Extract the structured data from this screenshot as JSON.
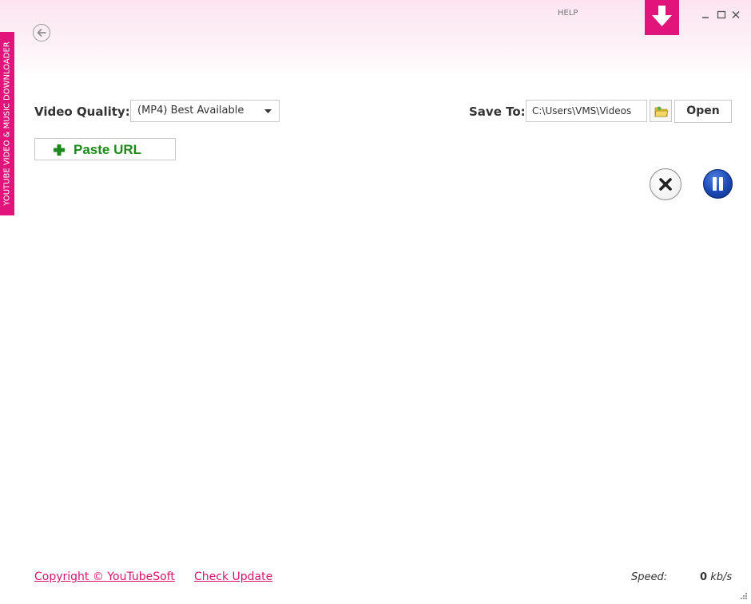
{
  "sidebar": {
    "title": "YOUTUBE VIDEO & MUSIC DOWNLOADER"
  },
  "header": {
    "help_label": "HELP",
    "logo_icon": "download-arrow-icon",
    "window_controls": [
      "minimize-icon",
      "maximize-icon",
      "close-icon"
    ]
  },
  "toolbar": {
    "quality_label": "Video Quality:",
    "quality_selected": "(MP4) Best Available",
    "save_label": "Save To:",
    "save_path": "C:\\Users\\VMS\\Videos",
    "folder_icon": "folder-icon",
    "open_label": "Open",
    "paste_label": "Paste URL"
  },
  "actions": {
    "cancel_icon": "cancel-icon",
    "pause_icon": "pause-icon"
  },
  "footer": {
    "copyright": "Copyright © YouTubeSoft",
    "check_update": "Check Update",
    "speed_label": "Speed:",
    "speed_value": "0",
    "speed_unit": "kb/s"
  },
  "colors": {
    "accent": "#e0147a",
    "link": "#d8146f",
    "paste_green": "#1b8a1b",
    "pause_blue": "#1b49b5"
  }
}
